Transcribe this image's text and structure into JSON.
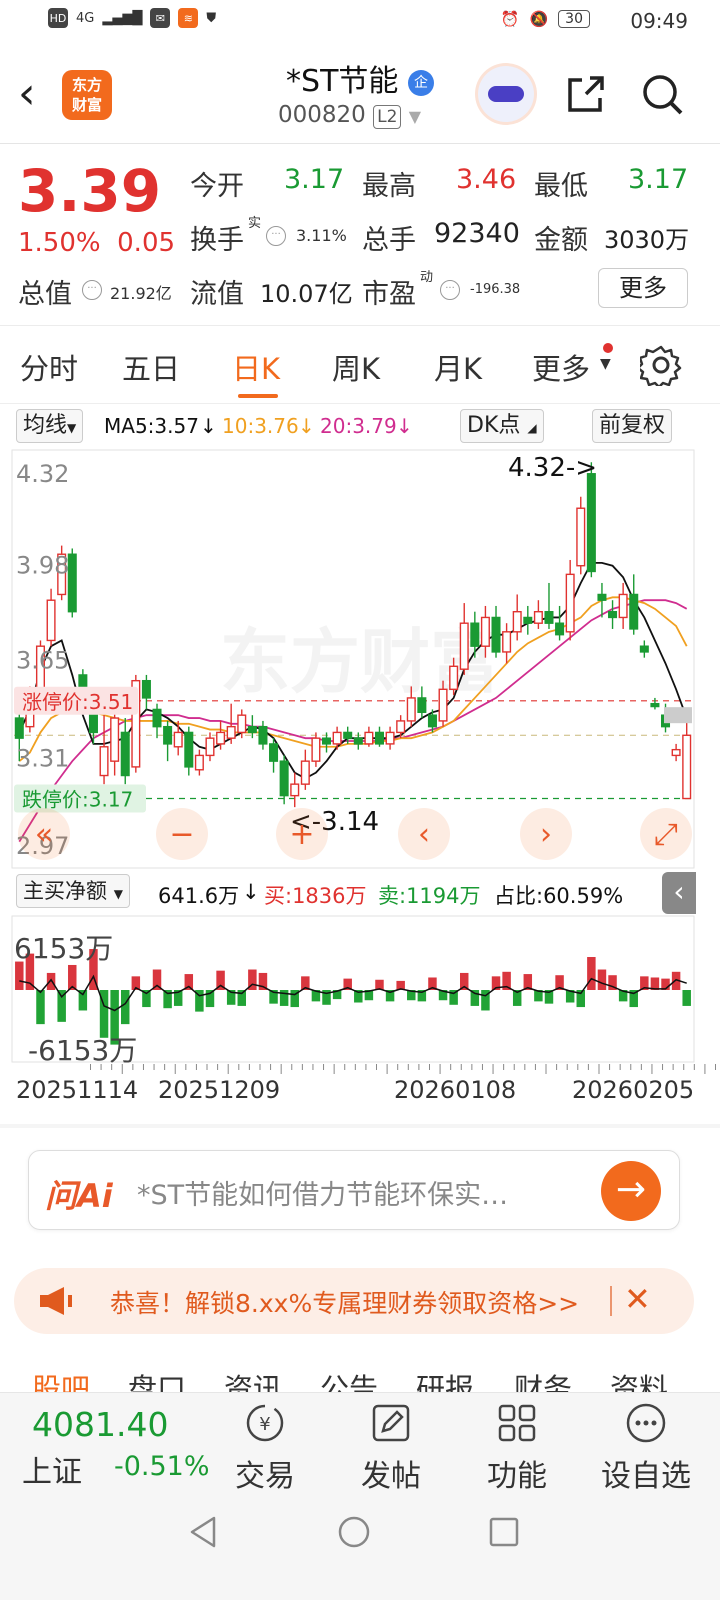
{
  "status": {
    "time": "09:49",
    "network": "4G",
    "battery": "30"
  },
  "header": {
    "back": "‹",
    "logo": "东方\n财富",
    "stock_name": "*ST节能",
    "name_badge": "企",
    "code": "000820",
    "level": "L2"
  },
  "quote": {
    "price": "3.39",
    "change_pct": "1.50%",
    "change_amt": "0.05",
    "open_label": "今开",
    "open": "3.17",
    "high_label": "最高",
    "high": "3.46",
    "low_label": "最低",
    "low": "3.17",
    "turnover_label": "换手",
    "turnover_sup": "实",
    "turnover": "3.11%",
    "volume_label": "总手",
    "volume": "92340",
    "amount_label": "金额",
    "amount": "3030万",
    "mktcap_label": "总值",
    "mktcap": "21.92亿",
    "float_label": "流值",
    "float": "10.07亿",
    "pe_label": "市盈",
    "pe_sup": "动",
    "pe": "-196.38",
    "more": "更多"
  },
  "tabs": [
    "分时",
    "五日",
    "日K",
    "周K",
    "月K",
    "更多"
  ],
  "active_tab": "日K",
  "chart_bar": {
    "ma_select": "均线",
    "ma5": "MA5:3.57",
    "ma10": "10:3.76",
    "ma20": "20:3.79",
    "dk": "DK点",
    "adjust": "前复权"
  },
  "colors": {
    "up": "#e0322f",
    "down": "#1a9a33",
    "ma5": "#111111",
    "ma10": "#f0a020",
    "ma20": "#d02d8f",
    "accent": "#f26a1d"
  },
  "chart_data": {
    "type": "candlestick",
    "y_ticks": [
      "4.32",
      "3.98",
      "3.65",
      "3.31",
      "2.97"
    ],
    "ylim": [
      2.97,
      4.32
    ],
    "limit_up_label": "涨停价:3.51",
    "limit_up": 3.51,
    "limit_down_label": "跌停价:3.17",
    "limit_down": 3.17,
    "max_label": "4.32->",
    "min_label": "<-3.14",
    "watermark": "东方财富",
    "candles": [
      [
        3.45,
        3.38,
        3.48,
        3.3
      ],
      [
        3.42,
        3.52,
        3.56,
        3.4
      ],
      [
        3.55,
        3.7,
        3.72,
        3.53
      ],
      [
        3.72,
        3.86,
        3.9,
        3.7
      ],
      [
        3.88,
        4.02,
        4.05,
        3.86
      ],
      [
        4.02,
        3.82,
        4.04,
        3.8
      ],
      [
        3.6,
        3.5,
        3.62,
        3.48
      ],
      [
        3.48,
        3.4,
        3.5,
        3.36
      ],
      [
        3.25,
        3.35,
        3.46,
        3.22
      ],
      [
        3.3,
        3.45,
        3.5,
        3.25
      ],
      [
        3.4,
        3.25,
        3.45,
        3.22
      ],
      [
        3.28,
        3.58,
        3.6,
        3.26
      ],
      [
        3.58,
        3.52,
        3.6,
        3.48
      ],
      [
        3.48,
        3.42,
        3.5,
        3.38
      ],
      [
        3.42,
        3.36,
        3.44,
        3.3
      ],
      [
        3.35,
        3.4,
        3.44,
        3.32
      ],
      [
        3.4,
        3.28,
        3.42,
        3.25
      ],
      [
        3.27,
        3.32,
        3.34,
        3.25
      ],
      [
        3.32,
        3.38,
        3.4,
        3.3
      ],
      [
        3.36,
        3.4,
        3.44,
        3.34
      ],
      [
        3.38,
        3.42,
        3.5,
        3.36
      ],
      [
        3.4,
        3.46,
        3.48,
        3.38
      ],
      [
        3.42,
        3.4,
        3.46,
        3.38
      ],
      [
        3.42,
        3.36,
        3.44,
        3.34
      ],
      [
        3.36,
        3.3,
        3.38,
        3.26
      ],
      [
        3.3,
        3.18,
        3.32,
        3.15
      ],
      [
        3.18,
        3.22,
        3.26,
        3.14
      ],
      [
        3.22,
        3.3,
        3.34,
        3.2
      ],
      [
        3.3,
        3.38,
        3.4,
        3.28
      ],
      [
        3.38,
        3.36,
        3.4,
        3.33
      ],
      [
        3.36,
        3.4,
        3.42,
        3.34
      ],
      [
        3.4,
        3.38,
        3.42,
        3.36
      ],
      [
        3.38,
        3.36,
        3.4,
        3.34
      ],
      [
        3.36,
        3.4,
        3.42,
        3.35
      ],
      [
        3.4,
        3.36,
        3.42,
        3.35
      ],
      [
        3.36,
        3.4,
        3.42,
        3.34
      ],
      [
        3.4,
        3.44,
        3.46,
        3.38
      ],
      [
        3.44,
        3.52,
        3.56,
        3.42
      ],
      [
        3.52,
        3.47,
        3.56,
        3.45
      ],
      [
        3.46,
        3.42,
        3.48,
        3.4
      ],
      [
        3.44,
        3.55,
        3.58,
        3.42
      ],
      [
        3.55,
        3.63,
        3.66,
        3.53
      ],
      [
        3.62,
        3.78,
        3.85,
        3.6
      ],
      [
        3.78,
        3.7,
        3.82,
        3.66
      ],
      [
        3.7,
        3.8,
        3.84,
        3.66
      ],
      [
        3.8,
        3.68,
        3.84,
        3.66
      ],
      [
        3.68,
        3.75,
        3.78,
        3.64
      ],
      [
        3.75,
        3.82,
        3.88,
        3.72
      ],
      [
        3.8,
        3.78,
        3.84,
        3.74
      ],
      [
        3.78,
        3.82,
        3.86,
        3.76
      ],
      [
        3.82,
        3.78,
        3.92,
        3.76
      ],
      [
        3.78,
        3.74,
        3.84,
        3.72
      ],
      [
        3.75,
        3.95,
        4.0,
        3.72
      ],
      [
        3.98,
        4.18,
        4.22,
        3.95
      ],
      [
        4.3,
        3.96,
        4.34,
        3.94
      ],
      [
        3.88,
        3.86,
        3.92,
        3.8
      ],
      [
        3.82,
        3.8,
        3.86,
        3.76
      ],
      [
        3.8,
        3.88,
        3.92,
        3.76
      ],
      [
        3.88,
        3.76,
        3.95,
        3.74
      ],
      [
        3.7,
        3.68,
        3.72,
        3.66
      ],
      [
        3.5,
        3.49,
        3.52,
        3.48
      ],
      [
        3.46,
        3.42,
        3.5,
        3.4
      ],
      [
        3.32,
        3.34,
        3.36,
        3.3
      ],
      [
        3.17,
        3.39,
        3.46,
        3.17
      ]
    ],
    "ma5_label": "MA5",
    "ma10_label": "10",
    "ma20_label": "20",
    "ma5": [
      3.4,
      3.48,
      3.62,
      3.7,
      3.72,
      3.6,
      3.46,
      3.36,
      3.36,
      3.37,
      3.38,
      3.44,
      3.48,
      3.47,
      3.45,
      3.42,
      3.38,
      3.35,
      3.34,
      3.36,
      3.38,
      3.4,
      3.42,
      3.41,
      3.38,
      3.32,
      3.26,
      3.24,
      3.26,
      3.3,
      3.35,
      3.38,
      3.38,
      3.38,
      3.38,
      3.38,
      3.39,
      3.42,
      3.45,
      3.47,
      3.48,
      3.52,
      3.62,
      3.68,
      3.72,
      3.74,
      3.74,
      3.76,
      3.78,
      3.79,
      3.8,
      3.8,
      3.84,
      3.92,
      3.99,
      3.99,
      3.98,
      3.94,
      3.86,
      3.8,
      3.72,
      3.64,
      3.55,
      3.45
    ],
    "ma10": [
      3.3,
      3.33,
      3.4,
      3.45,
      3.47,
      3.47,
      3.47,
      3.47,
      3.46,
      3.45,
      3.44,
      3.44,
      3.44,
      3.44,
      3.44,
      3.43,
      3.43,
      3.42,
      3.41,
      3.41,
      3.4,
      3.4,
      3.4,
      3.4,
      3.39,
      3.38,
      3.37,
      3.36,
      3.35,
      3.35,
      3.35,
      3.36,
      3.36,
      3.36,
      3.37,
      3.37,
      3.38,
      3.38,
      3.39,
      3.4,
      3.42,
      3.44,
      3.48,
      3.52,
      3.56,
      3.6,
      3.64,
      3.68,
      3.71,
      3.73,
      3.75,
      3.76,
      3.78,
      3.8,
      3.84,
      3.86,
      3.87,
      3.87,
      3.86,
      3.85,
      3.83,
      3.8,
      3.77,
      3.7
    ],
    "ma20": [
      3.02,
      3.08,
      3.14,
      3.2,
      3.25,
      3.3,
      3.34,
      3.38,
      3.4,
      3.42,
      3.44,
      3.45,
      3.46,
      3.46,
      3.46,
      3.46,
      3.45,
      3.45,
      3.44,
      3.44,
      3.43,
      3.43,
      3.42,
      3.42,
      3.41,
      3.4,
      3.39,
      3.38,
      3.38,
      3.37,
      3.37,
      3.37,
      3.37,
      3.37,
      3.37,
      3.38,
      3.38,
      3.39,
      3.4,
      3.41,
      3.42,
      3.44,
      3.46,
      3.48,
      3.5,
      3.52,
      3.55,
      3.58,
      3.61,
      3.64,
      3.67,
      3.7,
      3.73,
      3.76,
      3.79,
      3.81,
      3.83,
      3.84,
      3.85,
      3.86,
      3.86,
      3.86,
      3.85,
      3.83
    ]
  },
  "chart_controls": {
    "prev": "«",
    "zoom_out": "−",
    "zoom_in": "+",
    "left": "‹",
    "right": "›",
    "fullscreen": "⤢"
  },
  "indicator": {
    "select": "主买净额",
    "value": "641.6万",
    "buy": "买:1836万",
    "sell": "卖:1194万",
    "ratio": "占比:60.59%",
    "collapse": "‹"
  },
  "vol_data": {
    "top_label": "6153万",
    "bottom_label": "-6153万",
    "max": 6153,
    "values": [
      2500,
      3200,
      -3000,
      1500,
      -2800,
      2200,
      -1800,
      3600,
      -4200,
      -4800,
      -3000,
      1200,
      -1500,
      1800,
      -1600,
      -1400,
      1400,
      -1900,
      -1500,
      1700,
      -1300,
      -1400,
      1800,
      1500,
      -1200,
      -1400,
      -1500,
      1200,
      -1000,
      -1300,
      -800,
      1000,
      -1100,
      -900,
      900,
      -1000,
      800,
      -900,
      -1000,
      1100,
      -900,
      -1300,
      1500,
      -1400,
      -1800,
      1200,
      1600,
      -1400,
      1400,
      -1000,
      -1200,
      1300,
      -1100,
      -1500,
      2900,
      1800,
      1300,
      -1000,
      -1500,
      1200,
      1100,
      1000,
      1600,
      -1400
    ],
    "line": [
      800,
      600,
      -200,
      900,
      -600,
      300,
      -400,
      1200,
      -1400,
      -1800,
      -1200,
      200,
      -300,
      400,
      -300,
      -200,
      300,
      -500,
      -300,
      400,
      -200,
      -300,
      500,
      300,
      -200,
      -300,
      -400,
      200,
      -100,
      -300,
      -100,
      200,
      -200,
      -100,
      100,
      -200,
      100,
      -100,
      -200,
      200,
      -100,
      -300,
      300,
      -300,
      -500,
      200,
      300,
      -200,
      200,
      -100,
      -200,
      200,
      -100,
      -300,
      1000,
      600,
      300,
      -100,
      -300,
      200,
      100,
      100,
      900,
      600
    ]
  },
  "dates": [
    "20251114",
    "20251209",
    "20260108",
    "20260205"
  ],
  "ai": {
    "logo": "问Ai",
    "placeholder": "*ST节能如何借力节能环保实…",
    "go": "→"
  },
  "banner": {
    "text": "恭喜！解锁8.xx%专属理财券领取资格>>",
    "close": "✕"
  },
  "subtabs": [
    "股吧",
    "盘口",
    "资讯",
    "公告",
    "研报",
    "财务",
    "资料"
  ],
  "bottom": {
    "index_value": "4081.40",
    "index_name": "上证",
    "index_change": "-0.51%",
    "trade": "交易",
    "post": "发帖",
    "function": "功能",
    "watch": "设自选"
  }
}
